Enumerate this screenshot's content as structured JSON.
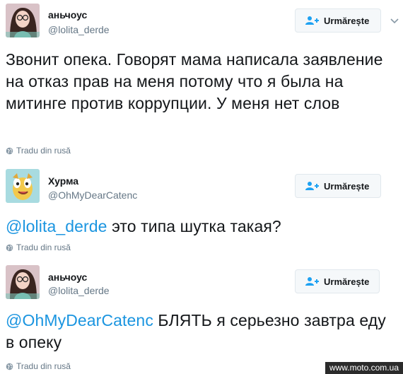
{
  "tweets": [
    {
      "name": "аньчоус",
      "handle": "@lolita_derde",
      "follow_label": "Urmărește",
      "mention": "",
      "text": "Звонит опека. Говорят мама написала заявление на отказ прав на меня потому что я была на митинге против коррупции. У меня нет слов",
      "translate_label": "Tradu din rusă"
    },
    {
      "name": "Хурма",
      "handle": "@OhMyDearCatenc",
      "follow_label": "Urmărește",
      "mention": "@lolita_derde",
      "text": " это типа шутка такая?",
      "translate_label": "Tradu din rusă"
    },
    {
      "name": "аньчоус",
      "handle": "@lolita_derde",
      "follow_label": "Urmărește",
      "mention": "@OhMyDearCatenc",
      "text": " БЛЯТЬ я серьезно завтра еду в опеку",
      "translate_label": "Tradu din rusă"
    }
  ],
  "watermark": "www.moto.com.ua",
  "colors": {
    "mention": "#1b95e0",
    "secondary_text": "#657786",
    "follow_icon": "#1da1f2"
  },
  "icons": {
    "follow": "user-plus-icon",
    "more": "chevron-down-icon",
    "translate": "globe-icon"
  }
}
